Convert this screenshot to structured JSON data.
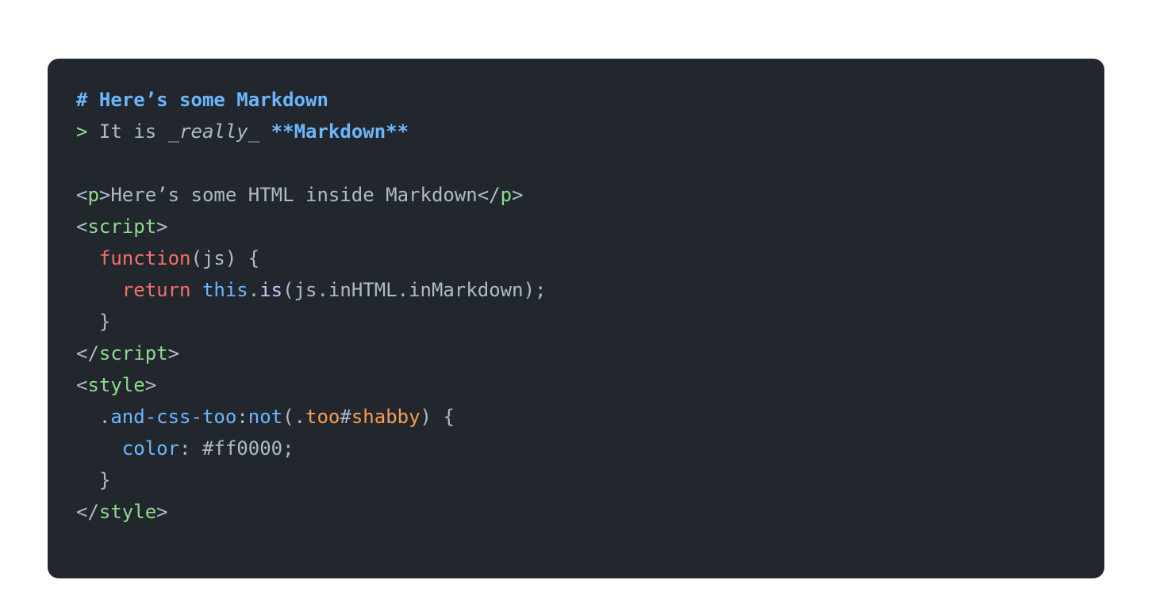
{
  "colors": {
    "bg": "#22272e",
    "heading": "#6cb6ff",
    "quote": "#8ddb8c",
    "text": "#adbac7",
    "emph": "#adbac7",
    "strong": "#6cb6ff",
    "punct": "#adbac7",
    "tag": "#8ddb8c",
    "keyword": "#f47067",
    "this": "#6cb6ff",
    "func": "#dcbdfb",
    "member": "#adbac7",
    "sel": "#6cb6ff",
    "class": "#f69d50",
    "prop": "#6cb6ff",
    "value": "#adbac7"
  },
  "syntax": {
    "lt": "<",
    "gt": ">",
    "lt_slash": "</",
    "open_brace": "{",
    "close_brace": "}",
    "open_paren": "(",
    "close_paren": ")",
    "semicolon": ";",
    "colon": ":",
    "comma": ",",
    "dot": ".",
    "hash": "#",
    "sp": " "
  },
  "code": {
    "md_heading_marker": "# ",
    "md_heading_text": "Here’s some Markdown",
    "md_quote_marker": "> ",
    "md_quote_text1": "It is ",
    "md_emph_open": "_",
    "md_emph_text": "really",
    "md_emph_close": "_",
    "md_space": " ",
    "md_strong_open": "**",
    "md_strong_text": "Markdown",
    "md_strong_close": "**",
    "tag_p": "p",
    "p_inner": "Here’s some HTML inside Markdown",
    "tag_script": "script",
    "tag_style": "style",
    "js_indent1": "  ",
    "js_indent2": "    ",
    "kw_function": "function",
    "param_js": "js",
    "kw_return": "return",
    "kw_this": "this",
    "method_is": "is",
    "prop_inHTML": "inHTML",
    "prop_inMarkdown": "inMarkdown",
    "css_sel_class": "and-css-too",
    "css_pseudo_not": "not",
    "css_notarg_class": "too",
    "css_notarg_id": "shabby",
    "css_prop_color": "color",
    "css_value_color": "#ff0000"
  }
}
